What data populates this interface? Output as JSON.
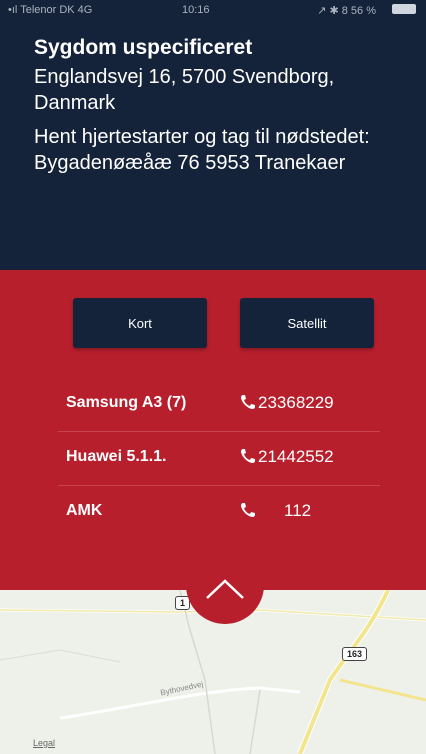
{
  "status_bar": {
    "carrier": "•ıl Telenor DK 4G",
    "time": "10:16",
    "right": "↗ ✱ 8 56 %"
  },
  "alert": {
    "title": "Sygdom uspecificeret",
    "address": "Englandsvej 16, 5700 Svendborg, Danmark",
    "instructions": "Hent hjertestarter og tag til nødstedet: Bygadenøæåæ 76 5953 Tranekaer"
  },
  "map_toggle": {
    "map_label": "Kort",
    "satellite_label": "Satellit"
  },
  "contacts": [
    {
      "name": "Samsung A3 (7)",
      "number": "23368229"
    },
    {
      "name": "Huawei 5.1.1.",
      "number": "21442552"
    },
    {
      "name": "AMK",
      "number": "112"
    }
  ],
  "map": {
    "road_163": "163",
    "road_1": "1",
    "street": "Bythovedvej",
    "credit": "Legal"
  },
  "colors": {
    "navy": "#14233a",
    "red": "#b71f2c"
  },
  "icons": {
    "phone": "phone-icon",
    "collapse": "chevron-up-icon"
  }
}
